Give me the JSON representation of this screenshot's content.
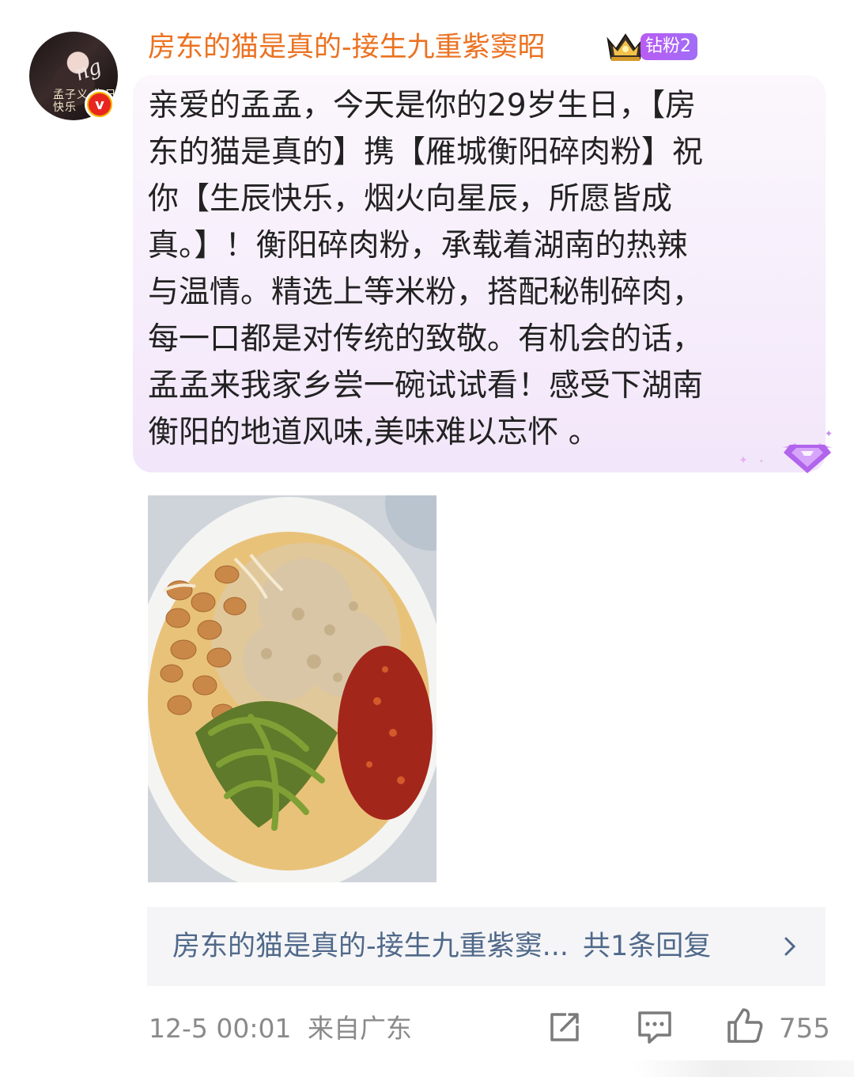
{
  "comment": {
    "username": "房东的猫是真的-接生九重紫窦昭",
    "fan_badge": "钻粉2",
    "avatar_text": "孟子义 生日快乐",
    "avatar_script": "ng",
    "text": "亲爱的孟孟，今天是你的29岁生日，【房\n东的猫是真的】携【雁城衡阳碎肉粉】祝\n你【生辰快乐，烟火向星辰，所愿皆成\n真。】！衡阳碎肉粉，承载着湖南的热辣\n与温情。精选上等米粉，搭配秘制碎肉，\n每一口都是对传统的致敬。有机会的话，\n孟孟来我家乡尝一碗试试看！感受下湖南\n衡阳的地道风味,美味难以忘怀 。",
    "image": {
      "alt": "衡阳碎肉粉",
      "icon": "photo"
    }
  },
  "reply_preview": {
    "author": "房东的猫是真的-接生九重紫窦...",
    "count_text": "共1条回复"
  },
  "footer": {
    "time": "12-5 00:01",
    "location": "来自广东",
    "like_count": "755"
  },
  "colors": {
    "username": "#eb7221",
    "badge": "#b85cf3",
    "reply_link": "#50698a",
    "meta": "#8a8a8a"
  },
  "icons": {
    "verified": "verified-v-icon",
    "crown": "crown-icon",
    "gem": "diamond-gem-icon",
    "chevron": "chevron-right-icon",
    "share": "share-icon",
    "comment": "comment-icon",
    "like": "thumbs-up-icon"
  }
}
